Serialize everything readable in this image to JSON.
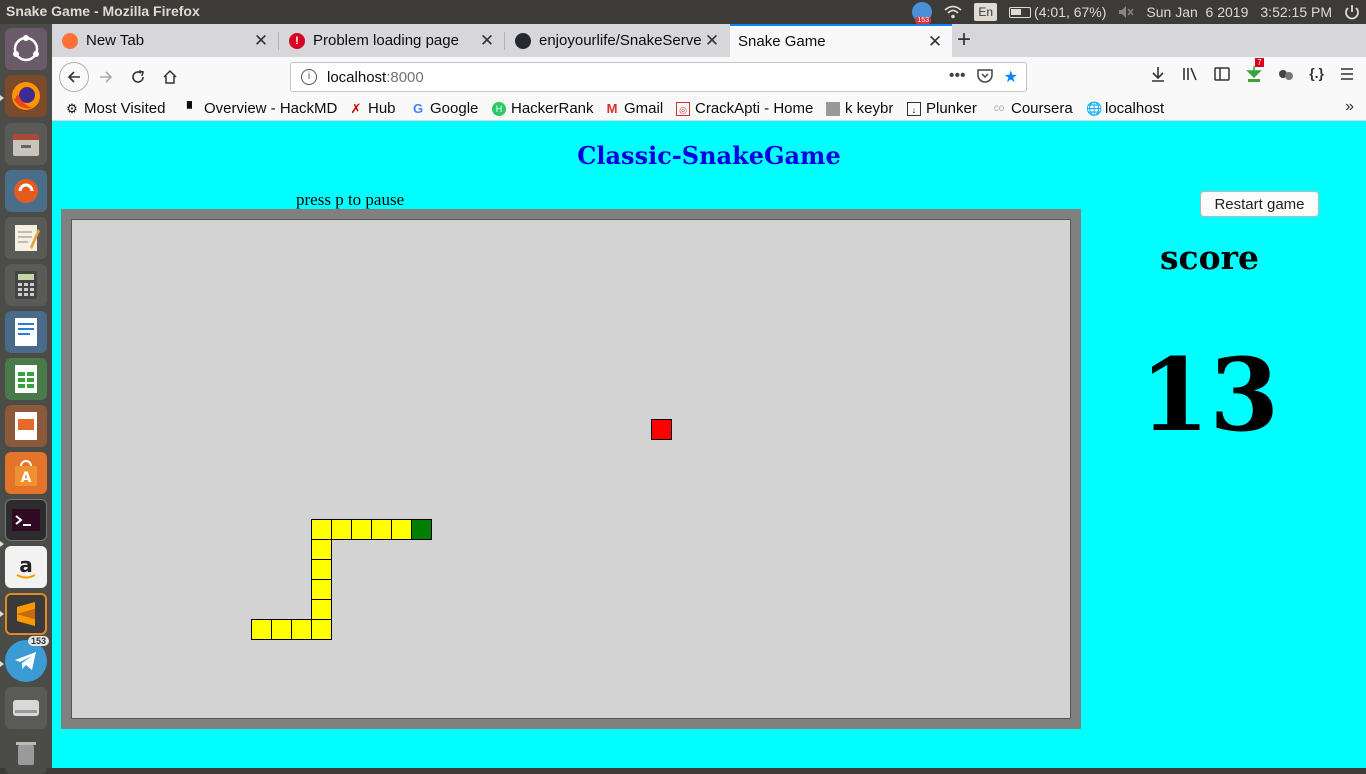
{
  "system": {
    "window_title": "Snake Game - Mozilla Firefox",
    "notification_count": "153",
    "keyboard_layout": "En",
    "battery": "(4:01, 67%)",
    "date": "Sun Jan  6 2019",
    "time": "3:52:15 PM"
  },
  "launcher": {
    "telegram_badge": "153",
    "items": [
      "ubuntu-dash",
      "firefox",
      "files",
      "software-updater",
      "text-editor",
      "calculator",
      "libreoffice-writer",
      "libreoffice-calc",
      "libreoffice-impress",
      "ubuntu-software",
      "terminal",
      "amazon",
      "sublime-text",
      "telegram",
      "disk",
      "trash"
    ]
  },
  "browser": {
    "tabs": [
      {
        "label": "New Tab",
        "icon": "firefox-icon",
        "active": false
      },
      {
        "label": "Problem loading page",
        "icon": "error-icon",
        "active": false
      },
      {
        "label": "enjoyourlife/SnakeServe",
        "icon": "github-icon",
        "active": false
      },
      {
        "label": "Snake Game",
        "icon": "none",
        "active": true
      }
    ],
    "new_tab": "+",
    "url_host": "localhost",
    "url_port": ":8000",
    "bookmarks_overflow": "»",
    "bookmarks": [
      {
        "label": "Most Visited",
        "icon": "gear-icon"
      },
      {
        "label": "Overview - HackMD",
        "icon": "document-icon"
      },
      {
        "label": "Hub",
        "icon": "hub-icon"
      },
      {
        "label": "Google",
        "icon": "google-icon"
      },
      {
        "label": "HackerRank",
        "icon": "hackerrank-icon"
      },
      {
        "label": "Gmail",
        "icon": "gmail-icon"
      },
      {
        "label": "CrackApti - Home",
        "icon": "crackapti-icon"
      },
      {
        "label": "k keybr",
        "icon": "keybr-icon"
      },
      {
        "label": "Plunker",
        "icon": "plunker-icon"
      },
      {
        "label": "Coursera",
        "icon": "coursera-icon"
      },
      {
        "label": "localhost",
        "icon": "globe-icon"
      }
    ],
    "download_badge": "7"
  },
  "game": {
    "title": "Classic-SnakeGame",
    "pause_hint": "press p to pause",
    "restart_label": "Restart game",
    "score_label": "score",
    "score_value": "13",
    "colors": {
      "page_bg": "#00ffff",
      "title": "#0000e0",
      "board": "#d3d3d3",
      "frame": "#808080",
      "snake_body": "#ffff00",
      "snake_head": "#008000",
      "food": "#ff0000"
    },
    "grid_cols": 50,
    "grid_rows": 25,
    "food": {
      "col": 29,
      "row": 10
    },
    "snake_head": {
      "col": 17,
      "row": 15
    },
    "snake_body": [
      {
        "col": 16,
        "row": 15
      },
      {
        "col": 15,
        "row": 15
      },
      {
        "col": 14,
        "row": 15
      },
      {
        "col": 13,
        "row": 15
      },
      {
        "col": 12,
        "row": 15
      },
      {
        "col": 12,
        "row": 16
      },
      {
        "col": 12,
        "row": 17
      },
      {
        "col": 12,
        "row": 18
      },
      {
        "col": 12,
        "row": 19
      },
      {
        "col": 12,
        "row": 20
      },
      {
        "col": 11,
        "row": 20
      },
      {
        "col": 10,
        "row": 20
      },
      {
        "col": 9,
        "row": 20
      }
    ]
  }
}
